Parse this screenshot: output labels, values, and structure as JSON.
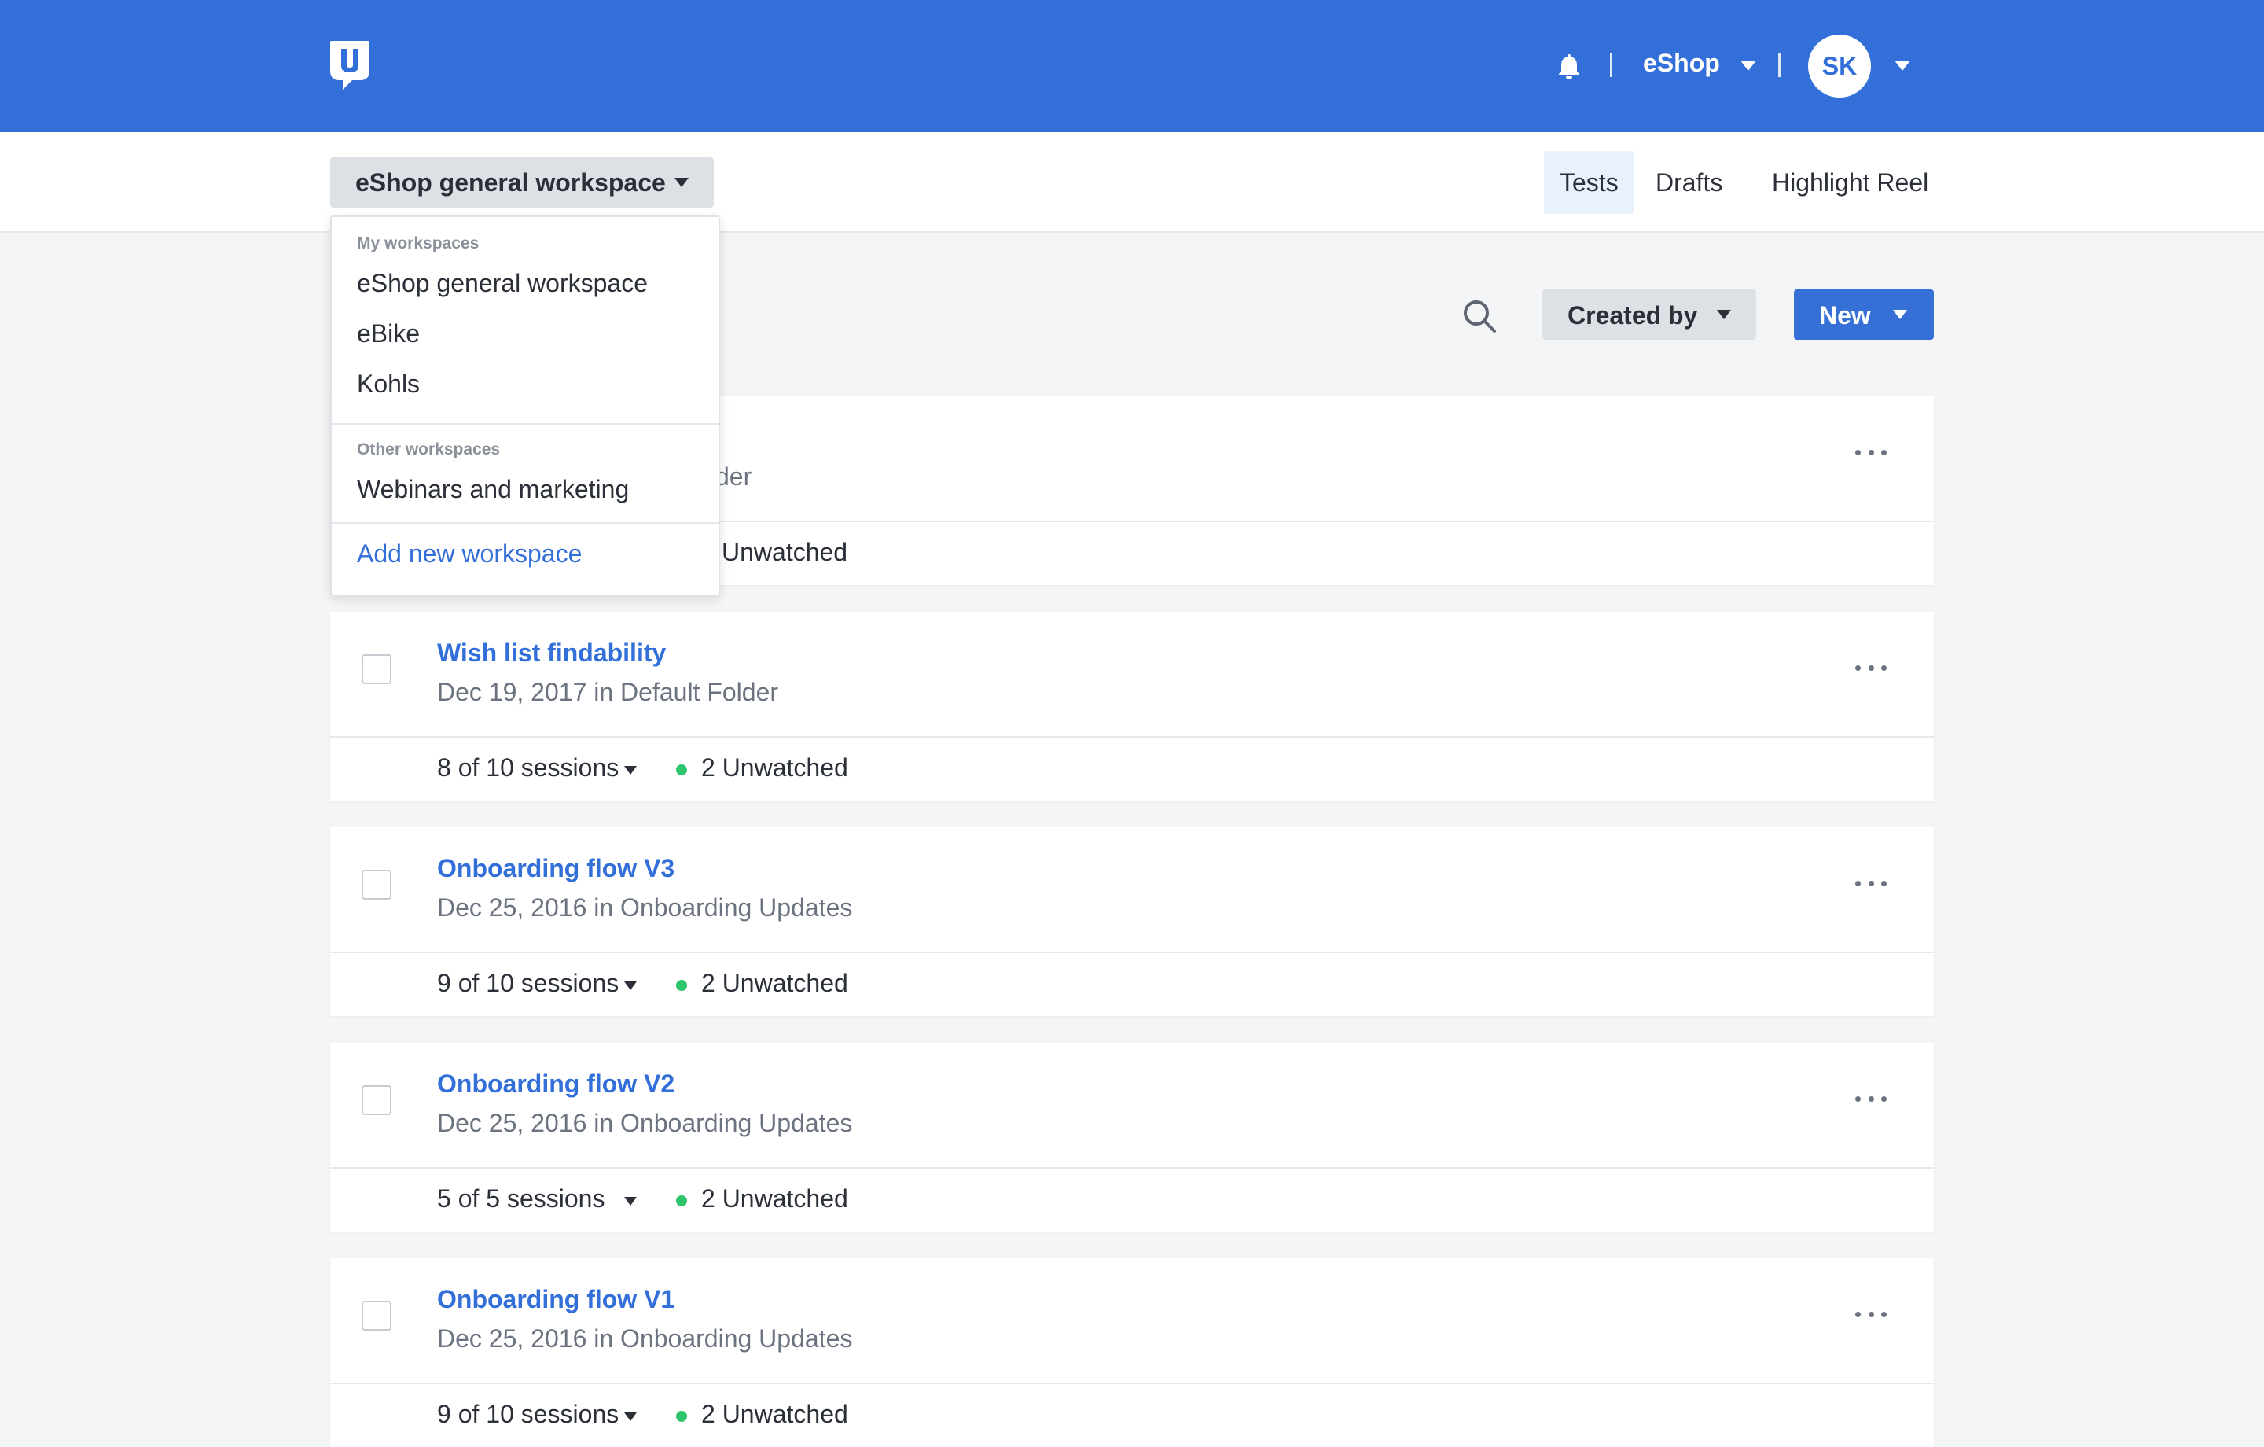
{
  "header": {
    "account_name": "eShop",
    "avatar_initials": "SK",
    "brand_color": "#336fd8"
  },
  "workspace": {
    "current": "eShop general workspace"
  },
  "tabs": [
    {
      "label": "Tests",
      "active": true
    },
    {
      "label": "Drafts",
      "active": false
    },
    {
      "label": "Highlight Reel",
      "active": false
    }
  ],
  "toolbar": {
    "created_by_label": "Created by",
    "new_label": "New"
  },
  "dropdown": {
    "my_heading": "My workspaces",
    "my_items": [
      "eShop general workspace",
      "eBike",
      "Kohls"
    ],
    "other_heading": "Other workspaces",
    "other_items": [
      "Webinars and marketing"
    ],
    "add_label": "Add new workspace"
  },
  "tests": [
    {
      "title": "",
      "meta": "der",
      "sessions": "",
      "unwatched": "Unwatched"
    },
    {
      "title": "Wish list findability",
      "meta": "Dec 19, 2017 in Default Folder",
      "sessions": "8 of 10 sessions",
      "unwatched": "2 Unwatched"
    },
    {
      "title": "Onboarding flow V3",
      "meta": "Dec 25, 2016 in Onboarding Updates",
      "sessions": "9 of 10 sessions",
      "unwatched": "2 Unwatched"
    },
    {
      "title": "Onboarding flow V2",
      "meta": "Dec 25, 2016 in Onboarding Updates",
      "sessions": "5 of 5 sessions",
      "unwatched": "2 Unwatched"
    },
    {
      "title": "Onboarding flow V1",
      "meta": "Dec 25, 2016 in Onboarding Updates",
      "sessions": "9 of 10 sessions",
      "unwatched": "2 Unwatched"
    }
  ],
  "status_colors": {
    "unwatched_dot": "#2ec46b"
  }
}
